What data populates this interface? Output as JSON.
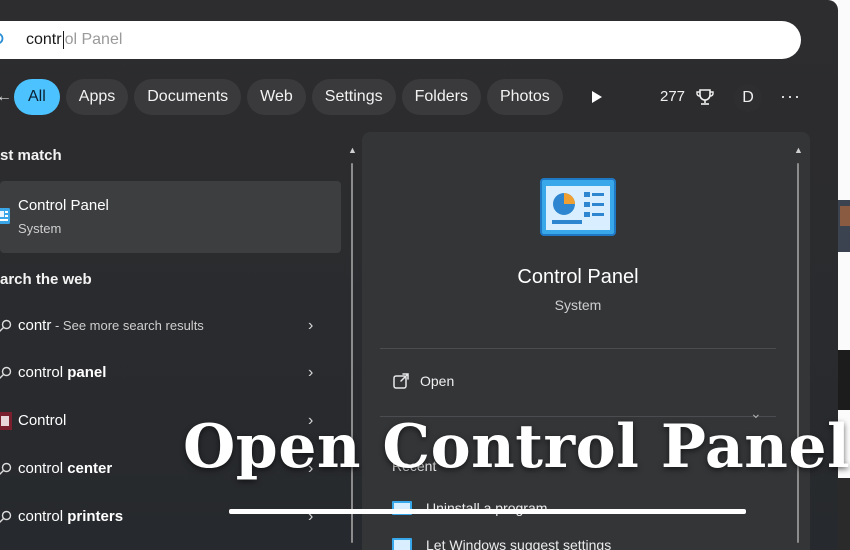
{
  "search": {
    "typed": "contr",
    "ghost": "ol Panel"
  },
  "filters": {
    "chips": [
      "All",
      "Apps",
      "Documents",
      "Web",
      "Settings",
      "Folders",
      "Photos"
    ],
    "count": "277",
    "avatar_letter": "D",
    "more": "···"
  },
  "left": {
    "best_match_heading": "st match",
    "best_match": {
      "title": "Control Panel",
      "subtitle": "System"
    },
    "web_heading": "arch the web",
    "web_results": [
      {
        "text": "contr",
        "suffix": " - See more search results",
        "bold": ""
      },
      {
        "text": "control ",
        "bold": "panel",
        "suffix": ""
      },
      {
        "text": "Control",
        "bold": "",
        "suffix": ""
      },
      {
        "text": "control ",
        "bold": "center",
        "suffix": ""
      },
      {
        "text": "control ",
        "bold": "printers",
        "suffix": ""
      }
    ]
  },
  "detail": {
    "title": "Control Panel",
    "subtitle": "System",
    "open_label": "Open",
    "recent_label": "Recent",
    "recent_items": [
      "Uninstall a program",
      "Let Windows suggest settings"
    ]
  },
  "overlay": {
    "title": "Open Control Panel"
  },
  "colors": {
    "accent": "#4cc2ff",
    "panel": "#2d2d2f",
    "detail_pane": "#333537"
  }
}
